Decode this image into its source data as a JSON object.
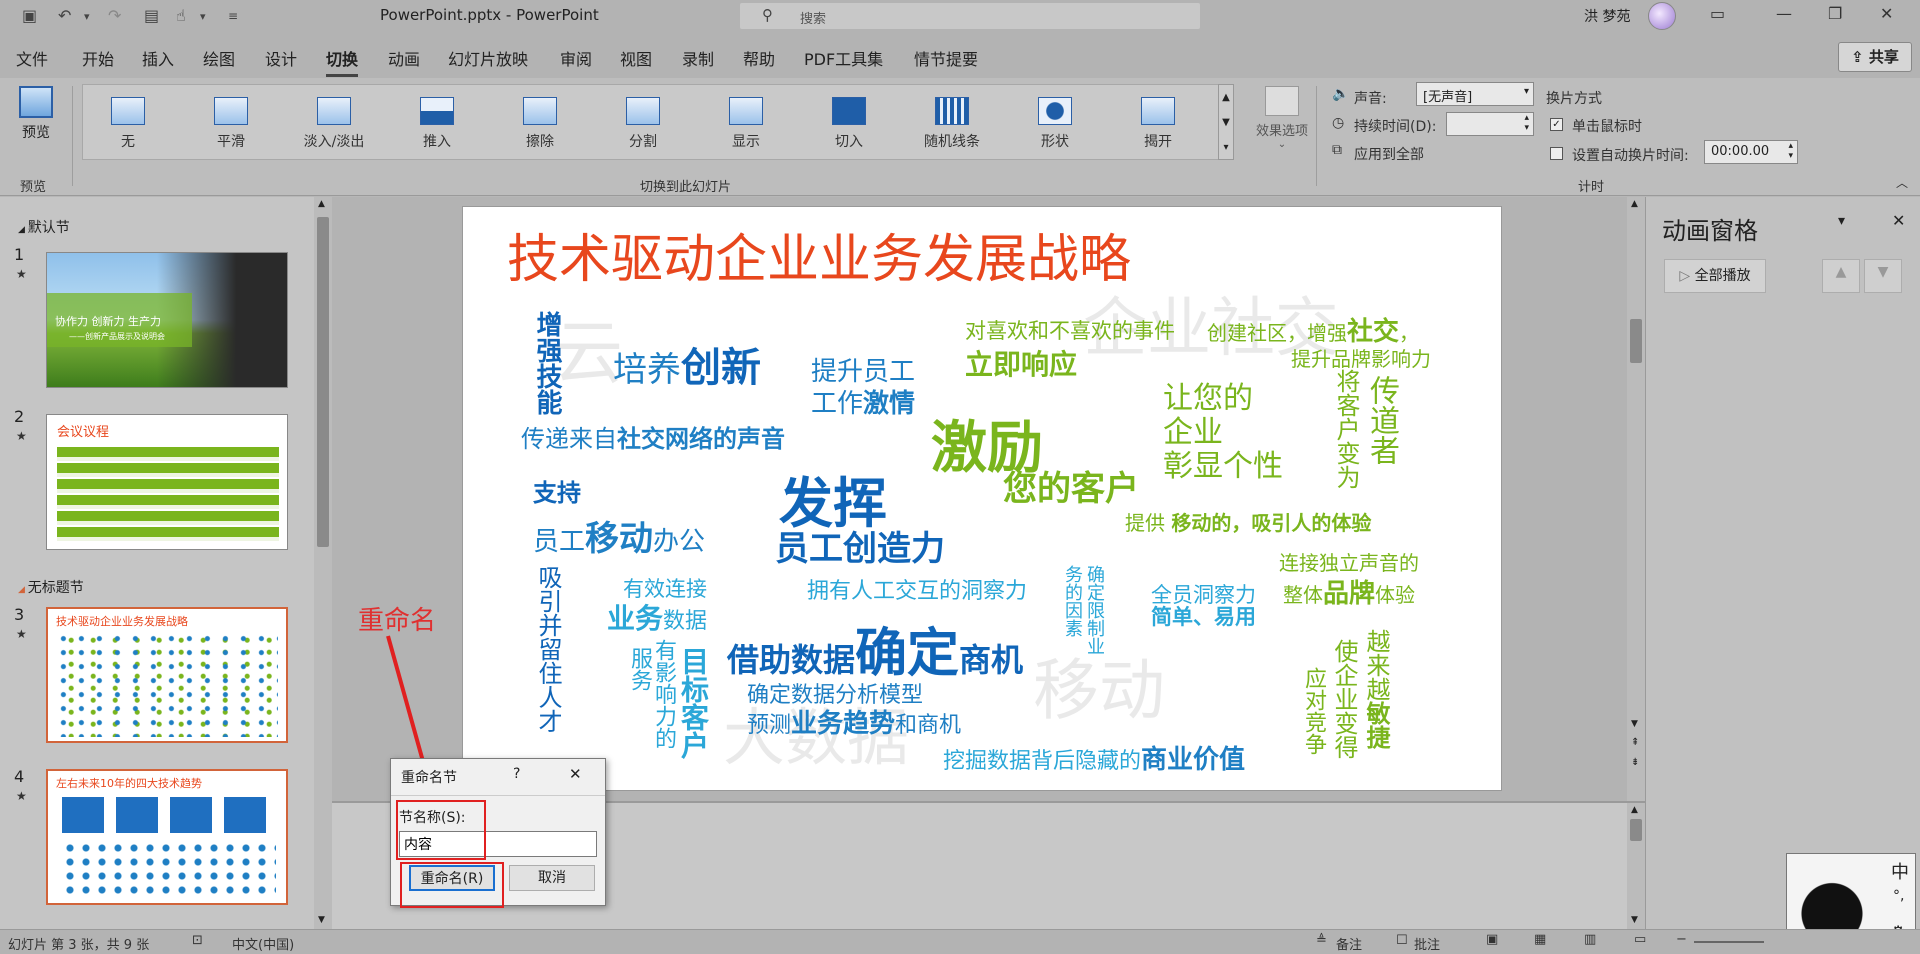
{
  "titlebar": {
    "doc_title": "PowerPoint.pptx - PowerPoint",
    "search_placeholder": "搜索",
    "user_name": "洪 梦苑"
  },
  "menu": {
    "items": [
      "文件",
      "开始",
      "插入",
      "绘图",
      "设计",
      "切换",
      "动画",
      "幻灯片放映",
      "审阅",
      "视图",
      "录制",
      "帮助",
      "PDF工具集",
      "情节提要"
    ],
    "active_index": 5,
    "share": "共享"
  },
  "ribbon": {
    "preview": "预览",
    "preview_group": "预览",
    "transitions": [
      "无",
      "平滑",
      "淡入/淡出",
      "推入",
      "擦除",
      "分割",
      "显示",
      "切入",
      "随机线条",
      "形状",
      "揭开"
    ],
    "effect_options": "效果选项",
    "group_label": "切换到此幻灯片",
    "sound_label": "声音:",
    "sound_value": "[无声音]",
    "duration_label": "持续时间(D):",
    "apply_all": "应用到全部",
    "switch_mode": "换片方式",
    "on_click": "单击鼠标时",
    "auto_after": "设置自动换片时间:",
    "auto_value": "00:00.00",
    "timing_group": "计时"
  },
  "thumbs": {
    "section1": "默认节",
    "section2": "无标题节",
    "slides": [
      {
        "num": "1",
        "text1": "协作力  创新力  生产力",
        "text2": "——创新产品展示及说明会"
      },
      {
        "num": "2",
        "title": "会议议程"
      },
      {
        "num": "3",
        "title": "技术驱动企业业务发展战略"
      },
      {
        "num": "4",
        "title": "左右未来10年的四大技术趋势"
      }
    ],
    "star": "★"
  },
  "slide": {
    "title": "技术驱动企业业务发展战略",
    "words": {
      "zengqiang_jineng": "增强技能",
      "peiyang": "培养",
      "chuangxin": "创新",
      "tisheng1": "提升员工",
      "tisheng2a": "工作",
      "tisheng2b": "激情",
      "chuandi_a": "传递来自",
      "chuandi_b": "社交网络的声音",
      "duixihuan": "对喜欢和不喜欢的事件",
      "lijixiangying": "立即响应",
      "chuangjian_a": "创建社区，增强",
      "chuangjian_b": "社交",
      "chuangjian_c": "，",
      "tisheng_pinpai": "提升品牌影响力",
      "jili": "激励",
      "nindekehu": "您的客户",
      "rangnin1": "让您的",
      "rangnin2": "企业",
      "rangnin3": "彰显个性",
      "kehubian_a": "将客户变为",
      "kehubian_b": "传道者",
      "zhichi": "支持",
      "yuangong_a": "员工",
      "yuangong_b": "移动",
      "yuangong_c": "办公",
      "fahui": "发挥",
      "yuangong_chuangzaoli": "员工创造力",
      "tigong_a": "提供 ",
      "tigong_b": "移动的，吸引人的体验",
      "xiyin": "吸引并留住人才",
      "youxiao1": "有效连接",
      "youxiao2a": "业务",
      "youxiao2b": "数据",
      "yongyou": "拥有人工交互的洞察力",
      "queding_yinsu": "确定限制业务的因素",
      "quanyuan1": "全员洞察力",
      "quanyuan2": "简单、易用",
      "lianjie1": "连接独立声音的",
      "lianjie2a": "整体",
      "lianjie2b": "品牌",
      "lianjie2c": "体验",
      "jiezhu_a": "借助数据",
      "jiezhu_b": "确定",
      "jiezhu_c": "商机",
      "fuwu_a": "服务",
      "fuwu_b": "有影响力的",
      "fuwu_c": "目标客户",
      "queding_moxing": "确定数据分析模型",
      "yuce_a": "预测",
      "yuce_b": "业务趋势",
      "yuce_c": "和商机",
      "wajue_a": "挖掘数据背后隐藏的",
      "wajue_b": "商业价值",
      "yingdui": "应对竞争",
      "shiqiye": "使企业变得",
      "yuelaiyue_a": "越来越",
      "yuelaiyue_b": "敏捷"
    },
    "ghost": [
      "云",
      "企业社交",
      "移动",
      "大数据"
    ]
  },
  "annotation": "重命名",
  "dialog": {
    "title": "重命名节",
    "help": "?",
    "close": "✕",
    "label": "节名称(S):",
    "value": "内容",
    "ok": "重命名(R)",
    "cancel": "取消"
  },
  "anim_pane": {
    "title": "动画窗格",
    "play_all": "全部播放"
  },
  "status": {
    "slide_info": "幻灯片 第 3 张，共 9 张",
    "language": "中文(中国)",
    "notes": "备注",
    "comments": "批注"
  },
  "ime": {
    "zhong": "中",
    "punct": "°,"
  },
  "colors": {
    "title_orange": "#e8471d",
    "green": "#7ab51d",
    "blue": "#1f7fc4",
    "annotation_red": "#e02020"
  }
}
